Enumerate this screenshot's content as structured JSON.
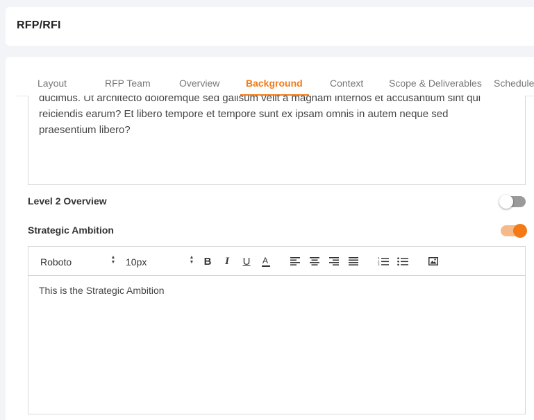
{
  "header": {
    "title": "RFP/RFI"
  },
  "tabs": [
    {
      "label": "Layout",
      "active": false
    },
    {
      "label": "RFP Team",
      "active": false
    },
    {
      "label": "Overview",
      "active": false
    },
    {
      "label": "Background",
      "active": true
    },
    {
      "label": "Context",
      "active": false
    },
    {
      "label": "Scope & Deliverables",
      "active": false
    },
    {
      "label": "Schedule",
      "active": false
    }
  ],
  "background_text": "ducimus. Ut architecto doloremque sed galisum velit a magnam internos et accusantium sint qui reiciendis earum? Et libero tempore et tempore sunt ex ipsam omnis in autem neque sed praesentium libero?",
  "level2": {
    "label": "Level 2 Overview",
    "enabled": false
  },
  "strategic": {
    "label": "Strategic Ambition",
    "enabled": true
  },
  "editor": {
    "font": "Roboto",
    "size": "10px",
    "content": "This is the Strategic Ambition",
    "toolbar_icons": [
      "bold-icon",
      "italic-icon",
      "underline-icon",
      "font-color-icon",
      "align-left-icon",
      "align-center-icon",
      "align-right-icon",
      "align-justify-icon",
      "ordered-list-icon",
      "bullet-list-icon",
      "image-icon"
    ]
  },
  "colors": {
    "accent": "#f47a16",
    "accent_light": "#f7b98a",
    "toggle_off": "#9a9a9a",
    "background": "#f2f4f7"
  }
}
